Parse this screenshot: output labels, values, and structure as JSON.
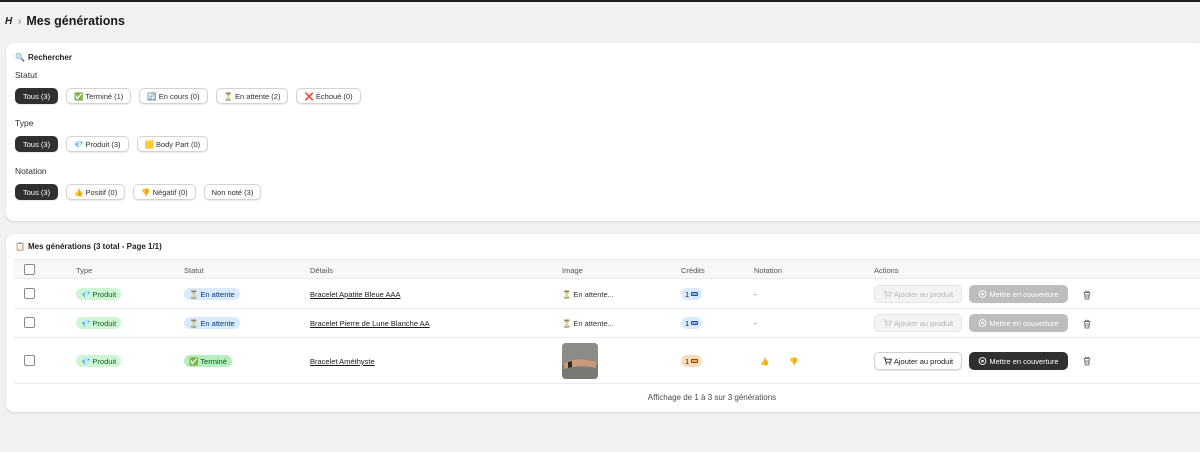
{
  "header": {
    "logo": "H",
    "chevron": "›",
    "title": "Mes générations"
  },
  "filters": {
    "search_icon": "🔍",
    "search_title": "Rechercher",
    "statut": {
      "label": "Statut",
      "chips": [
        "Tous (3)",
        "✅ Terminé (1)",
        "🔄 En cours (0)",
        "⏳ En attente (2)",
        "❌ Échoué (0)"
      ]
    },
    "type": {
      "label": "Type",
      "chips": [
        "Tous (3)",
        "💎 Produit (3)",
        "🟨 Body Part (0)"
      ]
    },
    "notation": {
      "label": "Notation",
      "chips": [
        "Tous (3)",
        "👍 Positif (0)",
        "👎 Négatif (0)",
        "Non noté (3)"
      ]
    }
  },
  "list": {
    "title_icon": "📋",
    "title": "Mes générations (3 total - Page 1/1)",
    "columns": [
      "Type",
      "Statut",
      "Détails",
      "Image",
      "Crédits",
      "Notation",
      "Actions"
    ],
    "rows": [
      {
        "type": "💎 Produit",
        "status": "⏳ En attente",
        "status_kind": "pending",
        "details": "Bracelet Apatite Bleue AAA",
        "image": "⏳ En attente...",
        "credits": "1",
        "notation": "-",
        "add": "Ajouter au produit",
        "cover": "Mettre en couverture"
      },
      {
        "type": "💎 Produit",
        "status": "⏳ En attente",
        "status_kind": "pending",
        "details": "Bracelet Pierre de Lune Blanche AA",
        "image": "⏳ En attente...",
        "credits": "1",
        "notation": "-",
        "add": "Ajouter au produit",
        "cover": "Mettre en couverture"
      },
      {
        "type": "💎 Produit",
        "status": "✅ Terminé",
        "status_kind": "done",
        "details": "Bracelet Améthyste",
        "image": "",
        "credits": "1",
        "thumb_up": "👍",
        "thumb_down": "👎",
        "add": "Ajouter au produit",
        "cover": "Mettre en couverture"
      }
    ],
    "footer": "Affichage de 1 à 3 sur 3 générations"
  }
}
